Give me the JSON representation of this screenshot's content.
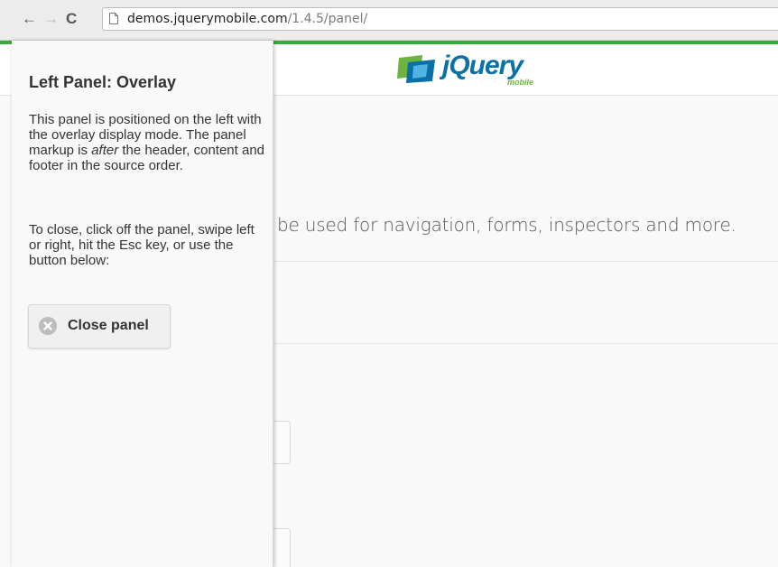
{
  "browser": {
    "back_glyph": "←",
    "forward_glyph": "→",
    "reload_glyph": "C",
    "url_host": "demos.jquerymobile.com",
    "url_path": "/1.4.5/panel/"
  },
  "header": {
    "logo_word": "jQuery",
    "logo_sub": "mobile"
  },
  "main": {
    "intro_text": "be used for navigation, forms, inspectors and more."
  },
  "panel": {
    "title": "Left Panel: Overlay",
    "p1_before": "This panel is positioned on the left with the overlay display mode. The panel markup is ",
    "p1_em": "after",
    "p1_after": " the header, content and footer in the source order.",
    "p2": "To close, click off the panel, swipe left or right, hit the Esc key, or use the button below:",
    "close_label": "Close panel"
  },
  "colors": {
    "accent": "#3eaa3a",
    "logo_blue": "#0a70a6",
    "logo_green": "#6cb33f"
  }
}
